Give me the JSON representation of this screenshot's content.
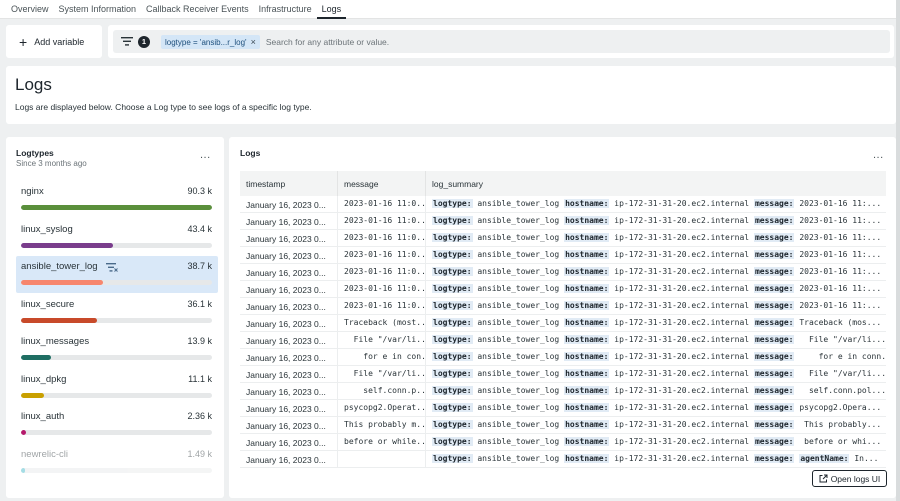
{
  "tabs": [
    {
      "label": "Overview",
      "active": false
    },
    {
      "label": "System Information",
      "active": false
    },
    {
      "label": "Callback Receiver Events",
      "active": false
    },
    {
      "label": "Infrastructure",
      "active": false
    },
    {
      "label": "Logs",
      "active": true
    }
  ],
  "toolbar": {
    "add_variable_label": "Add variable",
    "filter_count": "1",
    "filter_chip": "logtype = 'ansib...r_log'",
    "search_placeholder": "Search for any attribute or value."
  },
  "header": {
    "title": "Logs",
    "description": "Logs are displayed below. Choose a Log type to see logs of a specific log type."
  },
  "logtypes": {
    "title": "Logtypes",
    "subtitle": "Since 3 months ago",
    "items": [
      {
        "name": "nginx",
        "value": "90.3 k",
        "fraction": 1.0,
        "color": "#5a8f3b"
      },
      {
        "name": "linux_syslog",
        "value": "43.4 k",
        "fraction": 0.48,
        "color": "#7a3d8c"
      },
      {
        "name": "ansible_tower_log",
        "value": "38.7 k",
        "fraction": 0.43,
        "color": "#f7866d",
        "selected": true
      },
      {
        "name": "linux_secure",
        "value": "36.1 k",
        "fraction": 0.4,
        "color": "#c84a2a"
      },
      {
        "name": "linux_messages",
        "value": "13.9 k",
        "fraction": 0.155,
        "color": "#1f6e63"
      },
      {
        "name": "linux_dpkg",
        "value": "11.1 k",
        "fraction": 0.123,
        "color": "#c9a000"
      },
      {
        "name": "linux_auth",
        "value": "2.36 k",
        "fraction": 0.026,
        "color": "#b5196b"
      },
      {
        "name": "newrelic-cli",
        "value": "1.49 k",
        "fraction": 0.016,
        "color": "#3ab5c6",
        "faded": true
      }
    ]
  },
  "logs": {
    "title": "Logs",
    "columns": [
      "timestamp",
      "message",
      "log_summary"
    ],
    "summary_keys": {
      "logtype": "logtype:",
      "hostname": "hostname:",
      "message": "message:",
      "agent": "agentName:"
    },
    "rows": [
      {
        "timestamp": "January 16, 2023 0...",
        "message": "2023-01-16 11:0...",
        "logtype": "ansible_tower_log",
        "hostname": "ip-172-31-31-20.ec2.internal",
        "msg": "2023-01-16 11:..."
      },
      {
        "timestamp": "January 16, 2023 0...",
        "message": "2023-01-16 11:0...",
        "logtype": "ansible_tower_log",
        "hostname": "ip-172-31-31-20.ec2.internal",
        "msg": "2023-01-16 11:..."
      },
      {
        "timestamp": "January 16, 2023 0...",
        "message": "2023-01-16 11:0...",
        "logtype": "ansible_tower_log",
        "hostname": "ip-172-31-31-20.ec2.internal",
        "msg": "2023-01-16 11:..."
      },
      {
        "timestamp": "January 16, 2023 0...",
        "message": "2023-01-16 11:0...",
        "logtype": "ansible_tower_log",
        "hostname": "ip-172-31-31-20.ec2.internal",
        "msg": "2023-01-16 11:..."
      },
      {
        "timestamp": "January 16, 2023 0...",
        "message": "2023-01-16 11:0...",
        "logtype": "ansible_tower_log",
        "hostname": "ip-172-31-31-20.ec2.internal",
        "msg": "2023-01-16 11:..."
      },
      {
        "timestamp": "January 16, 2023 0...",
        "message": "2023-01-16 11:0...",
        "logtype": "ansible_tower_log",
        "hostname": "ip-172-31-31-20.ec2.internal",
        "msg": "2023-01-16 11:..."
      },
      {
        "timestamp": "January 16, 2023 0...",
        "message": "2023-01-16 11:0...",
        "logtype": "ansible_tower_log",
        "hostname": "ip-172-31-31-20.ec2.internal",
        "msg": "2023-01-16 11:..."
      },
      {
        "timestamp": "January 16, 2023 0...",
        "message": "Traceback (most...",
        "logtype": "ansible_tower_log",
        "hostname": "ip-172-31-31-20.ec2.internal",
        "msg": "Traceback (mos..."
      },
      {
        "timestamp": "January 16, 2023 0...",
        "message": "  File \"/var/li...",
        "logtype": "ansible_tower_log",
        "hostname": "ip-172-31-31-20.ec2.internal",
        "msg": "  File \"/var/li..."
      },
      {
        "timestamp": "January 16, 2023 0...",
        "message": "    for e in con...",
        "logtype": "ansible_tower_log",
        "hostname": "ip-172-31-31-20.ec2.internal",
        "msg": "    for e in conn..."
      },
      {
        "timestamp": "January 16, 2023 0...",
        "message": "  File \"/var/li...",
        "logtype": "ansible_tower_log",
        "hostname": "ip-172-31-31-20.ec2.internal",
        "msg": "  File \"/var/li..."
      },
      {
        "timestamp": "January 16, 2023 0...",
        "message": "    self.conn.p...",
        "logtype": "ansible_tower_log",
        "hostname": "ip-172-31-31-20.ec2.internal",
        "msg": "  self.conn.pol..."
      },
      {
        "timestamp": "January 16, 2023 0...",
        "message": "psycopg2.Operat...",
        "logtype": "ansible_tower_log",
        "hostname": "ip-172-31-31-20.ec2.internal",
        "msg": "psycopg2.Opera..."
      },
      {
        "timestamp": "January 16, 2023 0...",
        "message": "This probably m...",
        "logtype": "ansible_tower_log",
        "hostname": "ip-172-31-31-20.ec2.internal",
        "msg": " This probably..."
      },
      {
        "timestamp": "January 16, 2023 0...",
        "message": "before or while...",
        "logtype": "ansible_tower_log",
        "hostname": "ip-172-31-31-20.ec2.internal",
        "msg": " before or whi..."
      },
      {
        "timestamp": "January 16, 2023 0...",
        "message": "",
        "logtype": "ansible_tower_log",
        "hostname": "ip-172-31-31-20.ec2.internal",
        "msg": "",
        "agent": "In..."
      }
    ],
    "open_button_label": "Open logs UI"
  }
}
